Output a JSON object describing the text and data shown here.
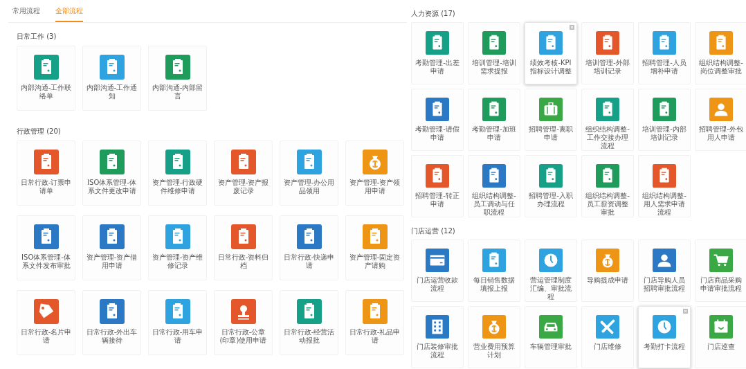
{
  "left_panel": {
    "tabs": [
      {
        "label": "常用流程",
        "selected": false
      },
      {
        "label": "全部流程",
        "selected": true
      }
    ],
    "sections": [
      {
        "title": "日常工作 (3)",
        "items": [
          {
            "label": "内部沟通-工作联络单",
            "kind": "clipboard",
            "color": "#17a088",
            "hovered": false
          },
          {
            "label": "内部沟通-工作通知",
            "kind": "clipboard",
            "color": "#2fa3df",
            "hovered": false
          },
          {
            "label": "内部沟通-内部留言",
            "kind": "clipboard",
            "color": "#1f9b5c",
            "hovered": false
          }
        ]
      },
      {
        "title": "行政管理 (20)",
        "items": [
          {
            "label": "日常行政-订票申请单",
            "kind": "clipboard",
            "color": "#e4572a",
            "hovered": false
          },
          {
            "label": "ISO体系管理-体系文件更改申请",
            "kind": "clipboard",
            "color": "#1f9b5c",
            "hovered": false
          },
          {
            "label": "资产管理-行政硬件维修申请",
            "kind": "clipboard",
            "color": "#17a088",
            "hovered": false
          },
          {
            "label": "资产管理-资产报废记录",
            "kind": "clipboard",
            "color": "#e4572a",
            "hovered": false
          },
          {
            "label": "资产管理-办公用品领用",
            "kind": "clipboard",
            "color": "#2fa3df",
            "hovered": false
          },
          {
            "label": "资产管理-资产领用申请",
            "kind": "money",
            "color": "#ef9516",
            "hovered": false
          },
          {
            "label": "ISO体系管理-体系文件发布审批",
            "kind": "clipboard",
            "color": "#2b78c4",
            "hovered": false
          },
          {
            "label": "资产管理-资产借用申请",
            "kind": "clipboard",
            "color": "#2b78c4",
            "hovered": false
          },
          {
            "label": "资产管理-资产维修记录",
            "kind": "clipboard",
            "color": "#2fa3df",
            "hovered": false
          },
          {
            "label": "日常行政-资料归档",
            "kind": "clipboard",
            "color": "#e4572a",
            "hovered": false
          },
          {
            "label": "日常行政-快递申请",
            "kind": "clipboard",
            "color": "#2b78c4",
            "hovered": false
          },
          {
            "label": "资产管理-固定资产请购",
            "kind": "clipboard",
            "color": "#ef9516",
            "hovered": false
          },
          {
            "label": "日常行政-名片申请",
            "kind": "tag",
            "color": "#e4572a",
            "hovered": false
          },
          {
            "label": "日常行政-外出车辆接待",
            "kind": "clipboard",
            "color": "#2b78c4",
            "hovered": false
          },
          {
            "label": "日常行政-用车申请",
            "kind": "clipboard",
            "color": "#2fa3df",
            "hovered": false
          },
          {
            "label": "日常行政-公章(印章)使用申请",
            "kind": "stamp",
            "color": "#e4572a",
            "hovered": false
          },
          {
            "label": "日常行政-经营活动报批",
            "kind": "clipboard",
            "color": "#17a088",
            "hovered": false
          },
          {
            "label": "日常行政-礼品申请",
            "kind": "clipboard",
            "color": "#ef9516",
            "hovered": false
          }
        ]
      }
    ]
  },
  "right_panel": {
    "sections": [
      {
        "title": "人力资源 (17)",
        "items": [
          {
            "label": "考勤管理-出差申请",
            "kind": "clipboard",
            "color": "#17a088",
            "hovered": false
          },
          {
            "label": "培训管理-培训需求提报",
            "kind": "clipboard",
            "color": "#1f9b5c",
            "hovered": false
          },
          {
            "label": "绩效考核-KPI指标设计调整",
            "kind": "clipboard",
            "color": "#2fa3df",
            "hovered": true
          },
          {
            "label": "培训管理-外部培训记录",
            "kind": "clipboard",
            "color": "#e4572a",
            "hovered": false
          },
          {
            "label": "招聘管理-人员增补申请",
            "kind": "clipboard",
            "color": "#2fa3df",
            "hovered": false
          },
          {
            "label": "组织结构调整-岗位调整审批",
            "kind": "clipboard",
            "color": "#ef9516",
            "hovered": false
          },
          {
            "label": "考勤管理-请假申请",
            "kind": "clipboard",
            "color": "#2b78c4",
            "hovered": false
          },
          {
            "label": "考勤管理-加班申请",
            "kind": "clipboard",
            "color": "#1f9b5c",
            "hovered": false
          },
          {
            "label": "招聘管理-离职申请",
            "kind": "briefcase",
            "color": "#3aa845",
            "hovered": false
          },
          {
            "label": "组织结构调整-工作交接办理流程",
            "kind": "clipboard",
            "color": "#17a088",
            "hovered": false
          },
          {
            "label": "培训管理-内部培训记录",
            "kind": "clipboard",
            "color": "#1f9b5c",
            "hovered": false
          },
          {
            "label": "招聘管理-外包用人申请",
            "kind": "person",
            "color": "#ef9516",
            "hovered": false
          },
          {
            "label": "招聘管理-转正申请",
            "kind": "clipboard",
            "color": "#e4572a",
            "hovered": false
          },
          {
            "label": "组织结构调整-员工调动与任职流程",
            "kind": "clipboard",
            "color": "#2b78c4",
            "hovered": false
          },
          {
            "label": "招聘管理-入职办理流程",
            "kind": "clipboard",
            "color": "#17a088",
            "hovered": false
          },
          {
            "label": "组织结构调整-员工薪资调整审批",
            "kind": "clipboard",
            "color": "#1f9b5c",
            "hovered": false
          },
          {
            "label": "组织结构调整-用人需求申请流程",
            "kind": "clipboard",
            "color": "#e4572a",
            "hovered": false
          }
        ]
      },
      {
        "title": "门店运营 (12)",
        "items": [
          {
            "label": "门店运营收款流程",
            "kind": "card",
            "color": "#2b78c4",
            "hovered": false
          },
          {
            "label": "每日销售数据填报上报",
            "kind": "clipboard",
            "color": "#2fa3df",
            "hovered": false
          },
          {
            "label": "营运管理制度汇编、审批流程",
            "kind": "clock",
            "color": "#2fa3df",
            "hovered": false
          },
          {
            "label": "导购提成申请",
            "kind": "money",
            "color": "#ef9516",
            "hovered": false
          },
          {
            "label": "门店导购人员招聘审批流程",
            "kind": "person",
            "color": "#2b78c4",
            "hovered": false
          },
          {
            "label": "门店商品采购申请审批流程",
            "kind": "cart",
            "color": "#3aa845",
            "hovered": false
          },
          {
            "label": "门店装修审批流程",
            "kind": "grid",
            "color": "#2b78c4",
            "hovered": false
          },
          {
            "label": "营业费用预算计划",
            "kind": "money",
            "color": "#ef9516",
            "hovered": false
          },
          {
            "label": "车辆管理审批",
            "kind": "car",
            "color": "#3aa845",
            "hovered": false
          },
          {
            "label": "门店维修",
            "kind": "tools",
            "color": "#2fa3df",
            "hovered": false
          },
          {
            "label": "考勤打卡流程",
            "kind": "clock",
            "color": "#2fa3df",
            "hovered": true
          },
          {
            "label": "门店巡查",
            "kind": "calendar",
            "color": "#3aa845",
            "hovered": false
          }
        ]
      }
    ]
  }
}
